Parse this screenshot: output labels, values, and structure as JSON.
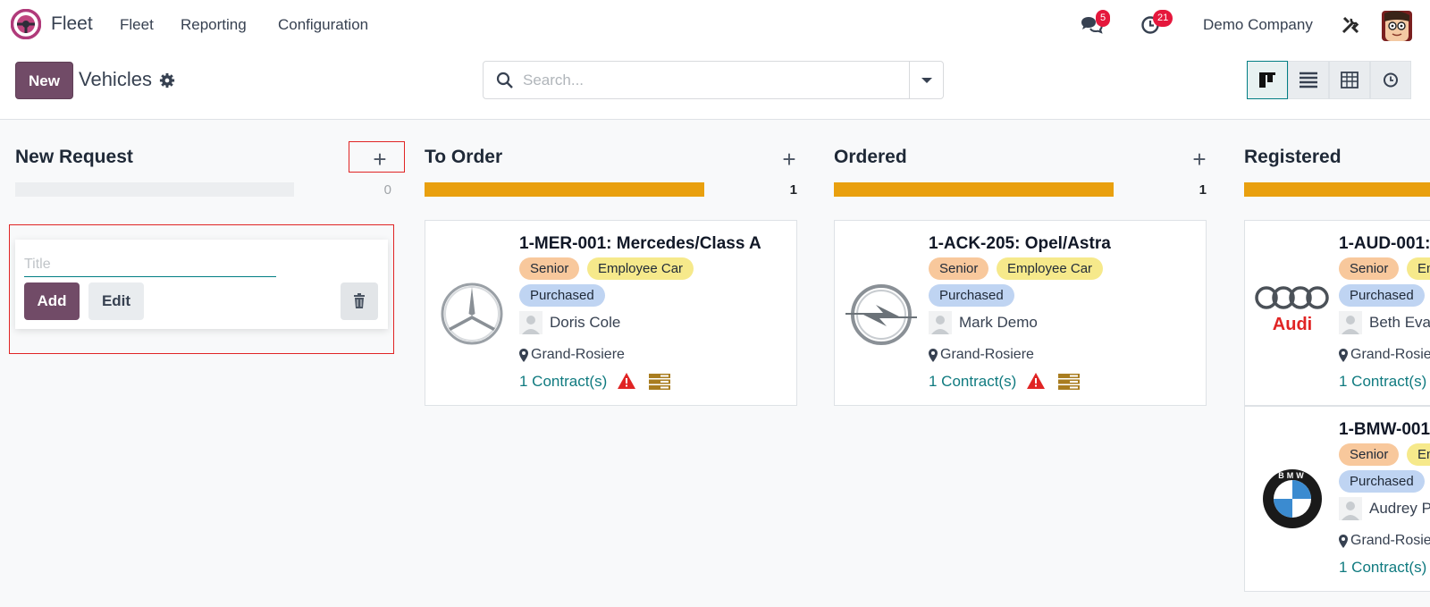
{
  "topbar": {
    "app_name": "Fleet",
    "menu": [
      "Fleet",
      "Reporting",
      "Configuration"
    ],
    "messages_badge": "5",
    "activities_badge": "21",
    "company": "Demo Company"
  },
  "control": {
    "new_label": "New",
    "page_title": "Vehicles",
    "search_placeholder": "Search..."
  },
  "columns": [
    {
      "title": "New Request",
      "count": "0",
      "progress": 0
    },
    {
      "title": "To Order",
      "count": "1",
      "progress": 1
    },
    {
      "title": "Ordered",
      "count": "1",
      "progress": 1
    },
    {
      "title": "Registered"
    }
  ],
  "quick_create": {
    "title_placeholder": "Title",
    "add_label": "Add",
    "edit_label": "Edit"
  },
  "cards": [
    {
      "title": "1-MER-001: Mercedes/Class A",
      "tags": [
        "Senior",
        "Employee Car",
        "Purchased"
      ],
      "driver": "Doris Cole",
      "location": "Grand-Rosiere",
      "contracts": "1 Contract(s)",
      "logo": "mercedes-logo"
    },
    {
      "title": "1-ACK-205: Opel/Astra",
      "tags": [
        "Senior",
        "Employee Car",
        "Purchased"
      ],
      "driver": "Mark Demo",
      "location": "Grand-Rosiere",
      "contracts": "1 Contract(s)",
      "logo": "opel-logo"
    },
    {
      "title": "1-AUD-001:",
      "tags": [
        "Senior",
        "Em",
        "Purchased"
      ],
      "driver": "Beth Evan",
      "location": "Grand-Rosie",
      "contracts": "1 Contract(s)",
      "logo": "audi-logo",
      "logo_text": "Audi"
    },
    {
      "title": "1-BMW-001",
      "tags": [
        "Senior",
        "Em",
        "Purchased"
      ],
      "driver": "Audrey P",
      "location": "Grand-Rosie",
      "contracts": "1 Contract(s)",
      "logo": "bmw-logo",
      "logo_text": "BMW"
    }
  ],
  "colors": {
    "primary": "#714b67",
    "progress": "#e9a00e",
    "link": "#0f7a7f",
    "badge": "#e5173c"
  }
}
